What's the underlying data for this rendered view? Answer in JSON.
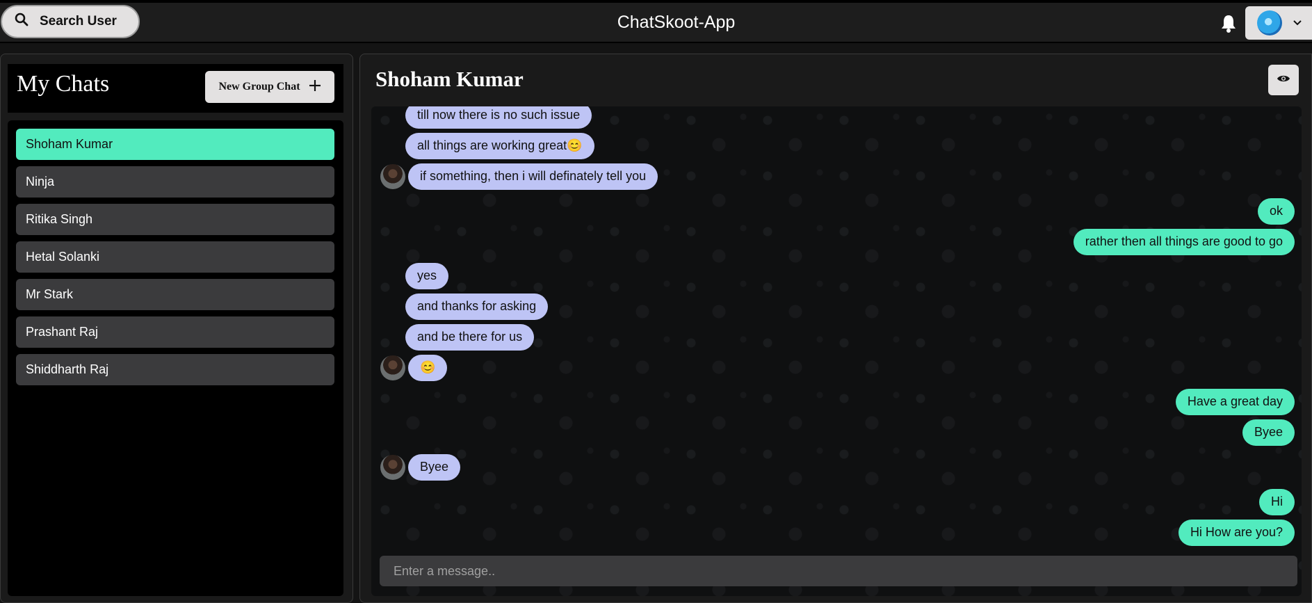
{
  "header": {
    "search_label": "Search User",
    "app_title": "ChatSkoot-App"
  },
  "sidebar": {
    "title": "My Chats",
    "new_group_label": "New Group Chat",
    "chats": [
      {
        "name": "Shoham Kumar",
        "active": true
      },
      {
        "name": "Ninja",
        "active": false
      },
      {
        "name": "Ritika Singh",
        "active": false
      },
      {
        "name": "Hetal Solanki",
        "active": false
      },
      {
        "name": "Mr Stark",
        "active": false
      },
      {
        "name": "Prashant Raj",
        "active": false
      },
      {
        "name": "Shiddharth Raj",
        "active": false
      }
    ]
  },
  "chat": {
    "title": "Shoham Kumar",
    "messages": [
      {
        "text": "till now there is no such issue",
        "from": "them",
        "show_avatar": false
      },
      {
        "text": "all things are working great😊",
        "from": "them",
        "show_avatar": false
      },
      {
        "text": "if something, then i will definately tell you",
        "from": "them",
        "show_avatar": true
      },
      {
        "text": "ok",
        "from": "me"
      },
      {
        "text": "rather then all things are good to go",
        "from": "me"
      },
      {
        "text": "yes",
        "from": "them",
        "show_avatar": false
      },
      {
        "text": "and thanks for asking",
        "from": "them",
        "show_avatar": false
      },
      {
        "text": "and be there for us",
        "from": "them",
        "show_avatar": false
      },
      {
        "text": "😊",
        "from": "them",
        "show_avatar": true
      },
      {
        "text": "Have a great day",
        "from": "me"
      },
      {
        "text": "Byee",
        "from": "me"
      },
      {
        "text": "Byee",
        "from": "them",
        "show_avatar": true
      },
      {
        "text": "Hi",
        "from": "me"
      },
      {
        "text": "Hi How are you?",
        "from": "me"
      }
    ],
    "input_placeholder": "Enter a message.."
  },
  "colors": {
    "accent": "#52ebbe",
    "incoming_bubble": "#bec4f5",
    "background": "#141414"
  },
  "icons": [
    "search-icon",
    "bell-icon",
    "chevron-down-icon",
    "plus-icon",
    "eye-icon"
  ]
}
